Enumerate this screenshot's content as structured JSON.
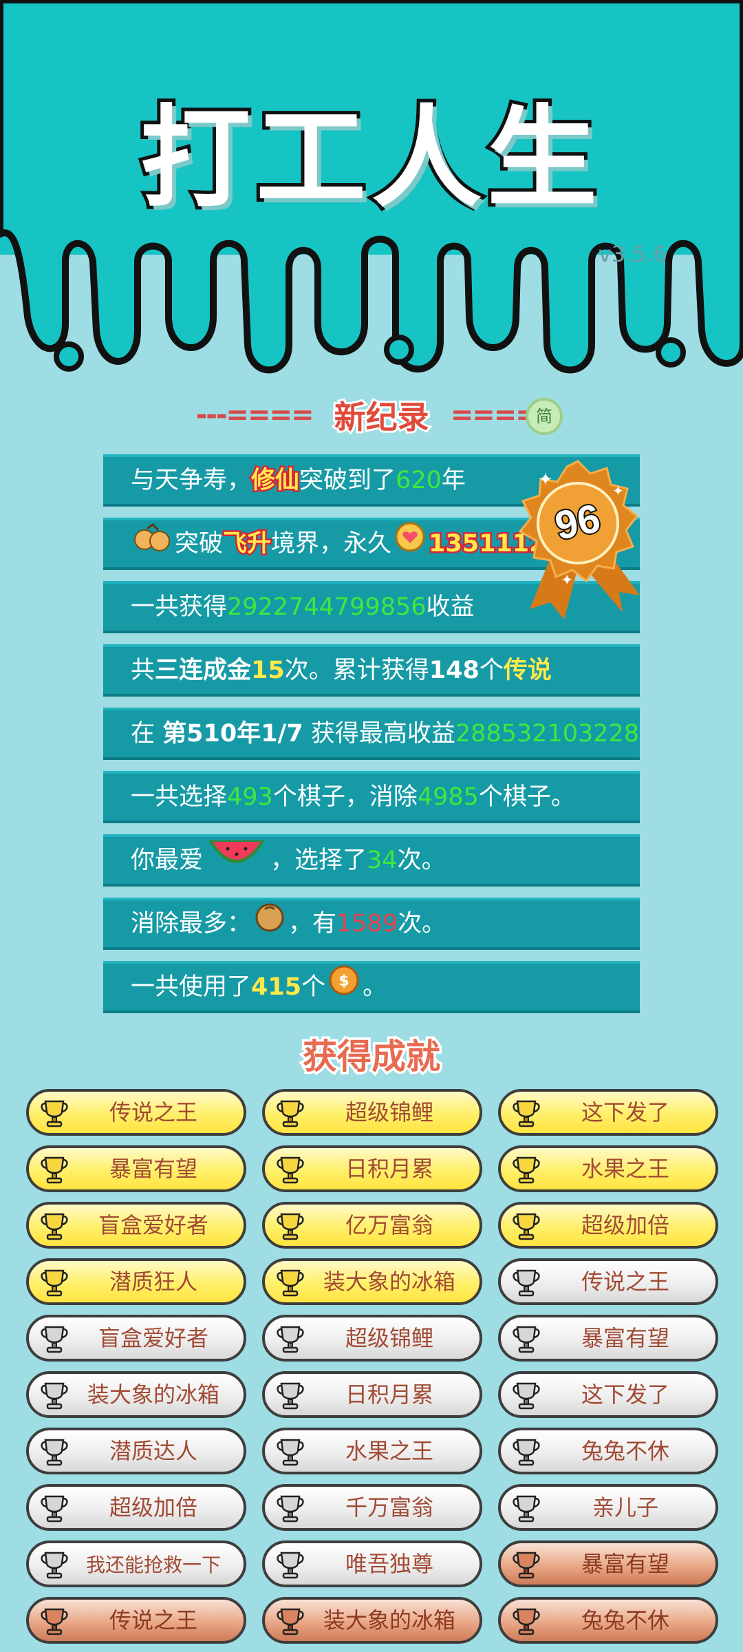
{
  "app": {
    "title": "打工人生",
    "version": "v3.5.6"
  },
  "record": {
    "label": "新纪录",
    "dash_left": "---====",
    "dash_right": "====-",
    "simple_badge": "简"
  },
  "medal": {
    "value": "96"
  },
  "stats": [
    {
      "parts": [
        {
          "t": "与天争寿，"
        },
        {
          "t": "修仙",
          "c": "hl"
        },
        {
          "t": "突破到了"
        },
        {
          "t": "620",
          "c": "g"
        },
        {
          "t": "年"
        }
      ]
    },
    {
      "parts": [
        {
          "icon": "orange-pair-icon"
        },
        {
          "t": "突破"
        },
        {
          "t": "飞升",
          "c": "hl"
        },
        {
          "t": "境界，永久"
        },
        {
          "icon": "heart-coin-icon"
        },
        {
          "t": "1351112",
          "c": "hl"
        }
      ]
    },
    {
      "parts": [
        {
          "t": "一共获得"
        },
        {
          "t": "2922744799856",
          "c": "g"
        },
        {
          "t": "收益"
        }
      ]
    },
    {
      "parts": [
        {
          "t": "共"
        },
        {
          "t": "三连成金",
          "c": "b"
        },
        {
          "t": "15",
          "c": "y"
        },
        {
          "t": "次。累计获得"
        },
        {
          "t": "148",
          "c": "b"
        },
        {
          "t": "个"
        },
        {
          "t": "传说",
          "c": "y"
        }
      ]
    },
    {
      "parts": [
        {
          "t": "在 "
        },
        {
          "t": "第510年1/7",
          "c": "b"
        },
        {
          "t": " 获得最高收益"
        },
        {
          "t": "288532103228",
          "c": "g"
        }
      ]
    },
    {
      "parts": [
        {
          "t": "一共选择"
        },
        {
          "t": "493",
          "c": "g"
        },
        {
          "t": "个棋子，消除"
        },
        {
          "t": "4985",
          "c": "g"
        },
        {
          "t": "个棋子。"
        }
      ]
    },
    {
      "parts": [
        {
          "t": "你最爱"
        },
        {
          "icon": "watermelon-icon"
        },
        {
          "t": "，选择了"
        },
        {
          "t": "34",
          "c": "g"
        },
        {
          "t": "次。"
        }
      ]
    },
    {
      "parts": [
        {
          "t": "消除最多："
        },
        {
          "icon": "nut-icon"
        },
        {
          "t": "，有"
        },
        {
          "t": "1589",
          "c": "r"
        },
        {
          "t": "次。"
        }
      ]
    },
    {
      "parts": [
        {
          "t": "一共使用了"
        },
        {
          "t": "415",
          "c": "y"
        },
        {
          "t": "个"
        },
        {
          "icon": "coin-icon"
        },
        {
          "t": "。"
        }
      ]
    }
  ],
  "achievements_title": "获得成就",
  "achievements": [
    {
      "label": "传说之王",
      "tier": "gold"
    },
    {
      "label": "超级锦鲤",
      "tier": "gold"
    },
    {
      "label": "这下发了",
      "tier": "gold"
    },
    {
      "label": "暴富有望",
      "tier": "gold"
    },
    {
      "label": "日积月累",
      "tier": "gold"
    },
    {
      "label": "水果之王",
      "tier": "gold"
    },
    {
      "label": "盲盒爱好者",
      "tier": "gold"
    },
    {
      "label": "亿万富翁",
      "tier": "gold"
    },
    {
      "label": "超级加倍",
      "tier": "gold"
    },
    {
      "label": "潜质狂人",
      "tier": "gold"
    },
    {
      "label": "装大象的冰箱",
      "tier": "gold"
    },
    {
      "label": "传说之王",
      "tier": "silver"
    },
    {
      "label": "盲盒爱好者",
      "tier": "silver"
    },
    {
      "label": "超级锦鲤",
      "tier": "silver"
    },
    {
      "label": "暴富有望",
      "tier": "silver"
    },
    {
      "label": "装大象的冰箱",
      "tier": "silver"
    },
    {
      "label": "日积月累",
      "tier": "silver"
    },
    {
      "label": "这下发了",
      "tier": "silver"
    },
    {
      "label": "潜质达人",
      "tier": "silver"
    },
    {
      "label": "水果之王",
      "tier": "silver"
    },
    {
      "label": "兔兔不休",
      "tier": "silver"
    },
    {
      "label": "超级加倍",
      "tier": "silver"
    },
    {
      "label": "千万富翁",
      "tier": "silver"
    },
    {
      "label": "亲儿子",
      "tier": "silver"
    },
    {
      "label": "我还能抢救一下",
      "tier": "silver"
    },
    {
      "label": "唯吾独尊",
      "tier": "silver"
    },
    {
      "label": "暴富有望",
      "tier": "bronze"
    },
    {
      "label": "传说之王",
      "tier": "bronze"
    },
    {
      "label": "装大象的冰箱",
      "tier": "bronze"
    },
    {
      "label": "兔兔不休",
      "tier": "bronze"
    }
  ],
  "colors": {
    "header_teal": "#17c4c4",
    "background": "#9edde3",
    "stat_row": "#169aa6",
    "highlight_green": "#3ee83e",
    "highlight_yellow": "#ffe94a",
    "medal_orange": "#e0861e"
  }
}
